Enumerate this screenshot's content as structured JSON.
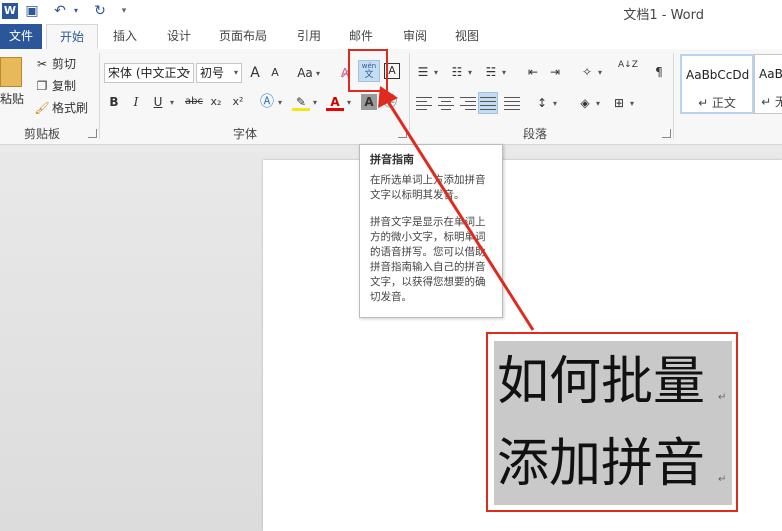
{
  "window": {
    "title": "文档1 - Word"
  },
  "quick_access": {
    "redo_separator": "▾"
  },
  "tabs": [
    {
      "label": "文件"
    },
    {
      "label": "开始"
    },
    {
      "label": "插入"
    },
    {
      "label": "设计"
    },
    {
      "label": "页面布局"
    },
    {
      "label": "引用"
    },
    {
      "label": "邮件"
    },
    {
      "label": "审阅"
    },
    {
      "label": "视图"
    }
  ],
  "clipboard": {
    "paste_label": "粘贴",
    "cut_label": "剪切",
    "copy_label": "复制",
    "format_painter_label": "格式刷",
    "group_label": "剪贴板"
  },
  "font": {
    "font_name": "宋体 (中文正文",
    "font_size": "初号",
    "grow": "A",
    "shrink": "A",
    "case": "Aa",
    "bold": "B",
    "italic": "I",
    "underline": "U",
    "strike": "abc",
    "subscript": "x₂",
    "superscript": "x²",
    "char_border": "A",
    "group_label": "字体"
  },
  "phonetic_button": {
    "top": "wén",
    "bottom": "文"
  },
  "paragraph": {
    "sort": "A↓Z",
    "group_label": "段落"
  },
  "styles": [
    {
      "sample": "AaBbCcDd",
      "name": "↵ 正文"
    },
    {
      "sample": "AaBb",
      "name": "↵ 无"
    }
  ],
  "tooltip": {
    "title": "拼音指南",
    "p1": "在所选单词上方添加拼音文字以标明其发音。",
    "p2": "拼音文字是显示在单词上方的微小文字，标明单词的语音拼写。您可以借助拼音指南输入自己的拼音文字，以获得您想要的确切发音。"
  },
  "document": {
    "line1": "如何批量",
    "line2": "添加拼音",
    "para_mark": "↵"
  },
  "colors": {
    "accent": "#2b579a",
    "highlight_red": "#e02a1f",
    "selection": "#c9c9c9"
  }
}
